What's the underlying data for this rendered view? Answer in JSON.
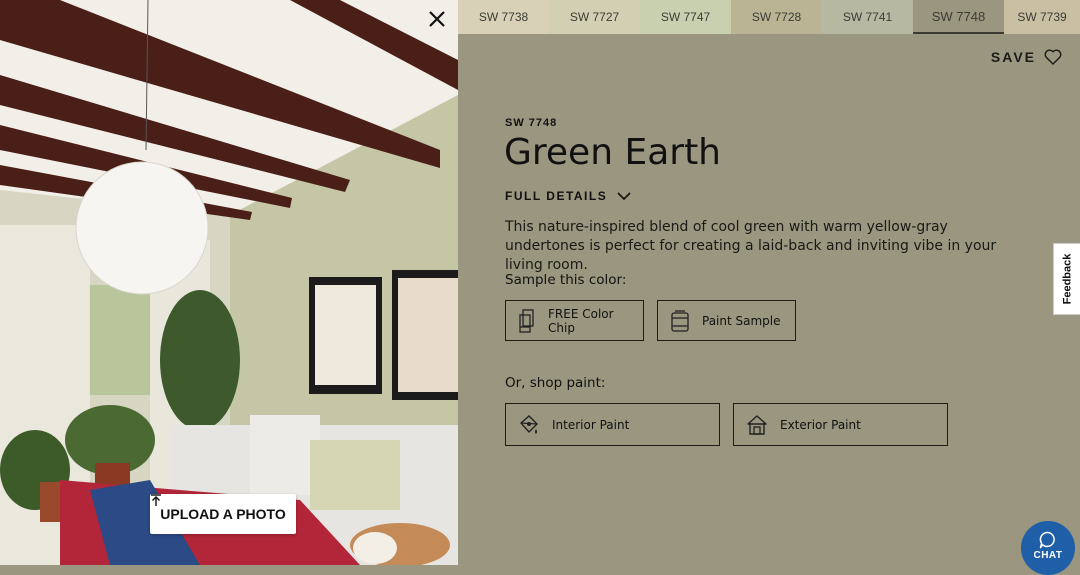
{
  "photo": {
    "alt_icon": "room-photo",
    "upload_label": "UPLOAD A PHOTO",
    "upload_icon": "upload-icon",
    "close_icon": "close-icon"
  },
  "swatches": [
    {
      "code": "SW 7738",
      "color": "#d8d1b8"
    },
    {
      "code": "SW 7727",
      "color": "#d3cfb2"
    },
    {
      "code": "SW 7747",
      "color": "#c9d0b0"
    },
    {
      "code": "SW 7728",
      "color": "#bab494"
    },
    {
      "code": "SW 7741",
      "color": "#b6b8a2"
    },
    {
      "code": "SW 7748",
      "color": "#9a967f",
      "active": true
    },
    {
      "code": "SW 7739",
      "color": "#c9c0a3"
    }
  ],
  "detail": {
    "save_label": "SAVE",
    "save_icon": "heart-icon",
    "code": "SW 7748",
    "name": "Green Earth",
    "full_details_label": "FULL DETAILS",
    "full_details_icon": "chevron-down-icon",
    "description": "This nature-inspired blend of cool green with warm yellow-gray undertones is perfect for creating a laid-back and inviting vibe in your living room.",
    "sample_label": "Sample this color:",
    "sample_buttons": [
      {
        "label": "FREE Color Chip",
        "icon": "color-chip-icon"
      },
      {
        "label": "Paint Sample",
        "icon": "paint-can-icon"
      }
    ],
    "shop_label": "Or, shop paint:",
    "shop_buttons": [
      {
        "label": "Interior Paint",
        "icon": "paint-bucket-icon"
      },
      {
        "label": "Exterior Paint",
        "icon": "house-icon"
      }
    ],
    "background_color": "#9a967f"
  },
  "feedback_label": "Feedback",
  "chat_label": "CHAT",
  "chat_color": "#1f5fa8"
}
